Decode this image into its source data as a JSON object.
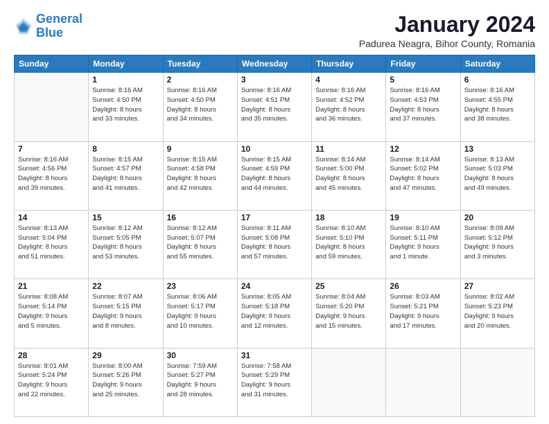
{
  "logo": {
    "line1": "General",
    "line2": "Blue"
  },
  "title": "January 2024",
  "subtitle": "Padurea Neagra, Bihor County, Romania",
  "days_of_week": [
    "Sunday",
    "Monday",
    "Tuesday",
    "Wednesday",
    "Thursday",
    "Friday",
    "Saturday"
  ],
  "weeks": [
    [
      {
        "day": "",
        "info": ""
      },
      {
        "day": "1",
        "info": "Sunrise: 8:16 AM\nSunset: 4:50 PM\nDaylight: 8 hours\nand 33 minutes."
      },
      {
        "day": "2",
        "info": "Sunrise: 8:16 AM\nSunset: 4:50 PM\nDaylight: 8 hours\nand 34 minutes."
      },
      {
        "day": "3",
        "info": "Sunrise: 8:16 AM\nSunset: 4:51 PM\nDaylight: 8 hours\nand 35 minutes."
      },
      {
        "day": "4",
        "info": "Sunrise: 8:16 AM\nSunset: 4:52 PM\nDaylight: 8 hours\nand 36 minutes."
      },
      {
        "day": "5",
        "info": "Sunrise: 8:16 AM\nSunset: 4:53 PM\nDaylight: 8 hours\nand 37 minutes."
      },
      {
        "day": "6",
        "info": "Sunrise: 8:16 AM\nSunset: 4:55 PM\nDaylight: 8 hours\nand 38 minutes."
      }
    ],
    [
      {
        "day": "7",
        "info": "Sunrise: 8:16 AM\nSunset: 4:56 PM\nDaylight: 8 hours\nand 39 minutes."
      },
      {
        "day": "8",
        "info": "Sunrise: 8:15 AM\nSunset: 4:57 PM\nDaylight: 8 hours\nand 41 minutes."
      },
      {
        "day": "9",
        "info": "Sunrise: 8:15 AM\nSunset: 4:58 PM\nDaylight: 8 hours\nand 42 minutes."
      },
      {
        "day": "10",
        "info": "Sunrise: 8:15 AM\nSunset: 4:59 PM\nDaylight: 8 hours\nand 44 minutes."
      },
      {
        "day": "11",
        "info": "Sunrise: 8:14 AM\nSunset: 5:00 PM\nDaylight: 8 hours\nand 45 minutes."
      },
      {
        "day": "12",
        "info": "Sunrise: 8:14 AM\nSunset: 5:02 PM\nDaylight: 8 hours\nand 47 minutes."
      },
      {
        "day": "13",
        "info": "Sunrise: 8:13 AM\nSunset: 5:03 PM\nDaylight: 8 hours\nand 49 minutes."
      }
    ],
    [
      {
        "day": "14",
        "info": "Sunrise: 8:13 AM\nSunset: 5:04 PM\nDaylight: 8 hours\nand 51 minutes."
      },
      {
        "day": "15",
        "info": "Sunrise: 8:12 AM\nSunset: 5:05 PM\nDaylight: 8 hours\nand 53 minutes."
      },
      {
        "day": "16",
        "info": "Sunrise: 8:12 AM\nSunset: 5:07 PM\nDaylight: 8 hours\nand 55 minutes."
      },
      {
        "day": "17",
        "info": "Sunrise: 8:11 AM\nSunset: 5:08 PM\nDaylight: 8 hours\nand 57 minutes."
      },
      {
        "day": "18",
        "info": "Sunrise: 8:10 AM\nSunset: 5:10 PM\nDaylight: 8 hours\nand 59 minutes."
      },
      {
        "day": "19",
        "info": "Sunrise: 8:10 AM\nSunset: 5:11 PM\nDaylight: 9 hours\nand 1 minute."
      },
      {
        "day": "20",
        "info": "Sunrise: 8:09 AM\nSunset: 5:12 PM\nDaylight: 9 hours\nand 3 minutes."
      }
    ],
    [
      {
        "day": "21",
        "info": "Sunrise: 8:08 AM\nSunset: 5:14 PM\nDaylight: 9 hours\nand 5 minutes."
      },
      {
        "day": "22",
        "info": "Sunrise: 8:07 AM\nSunset: 5:15 PM\nDaylight: 9 hours\nand 8 minutes."
      },
      {
        "day": "23",
        "info": "Sunrise: 8:06 AM\nSunset: 5:17 PM\nDaylight: 9 hours\nand 10 minutes."
      },
      {
        "day": "24",
        "info": "Sunrise: 8:05 AM\nSunset: 5:18 PM\nDaylight: 9 hours\nand 12 minutes."
      },
      {
        "day": "25",
        "info": "Sunrise: 8:04 AM\nSunset: 5:20 PM\nDaylight: 9 hours\nand 15 minutes."
      },
      {
        "day": "26",
        "info": "Sunrise: 8:03 AM\nSunset: 5:21 PM\nDaylight: 9 hours\nand 17 minutes."
      },
      {
        "day": "27",
        "info": "Sunrise: 8:02 AM\nSunset: 5:23 PM\nDaylight: 9 hours\nand 20 minutes."
      }
    ],
    [
      {
        "day": "28",
        "info": "Sunrise: 8:01 AM\nSunset: 5:24 PM\nDaylight: 9 hours\nand 22 minutes."
      },
      {
        "day": "29",
        "info": "Sunrise: 8:00 AM\nSunset: 5:26 PM\nDaylight: 9 hours\nand 25 minutes."
      },
      {
        "day": "30",
        "info": "Sunrise: 7:59 AM\nSunset: 5:27 PM\nDaylight: 9 hours\nand 28 minutes."
      },
      {
        "day": "31",
        "info": "Sunrise: 7:58 AM\nSunset: 5:29 PM\nDaylight: 9 hours\nand 31 minutes."
      },
      {
        "day": "",
        "info": ""
      },
      {
        "day": "",
        "info": ""
      },
      {
        "day": "",
        "info": ""
      }
    ]
  ]
}
